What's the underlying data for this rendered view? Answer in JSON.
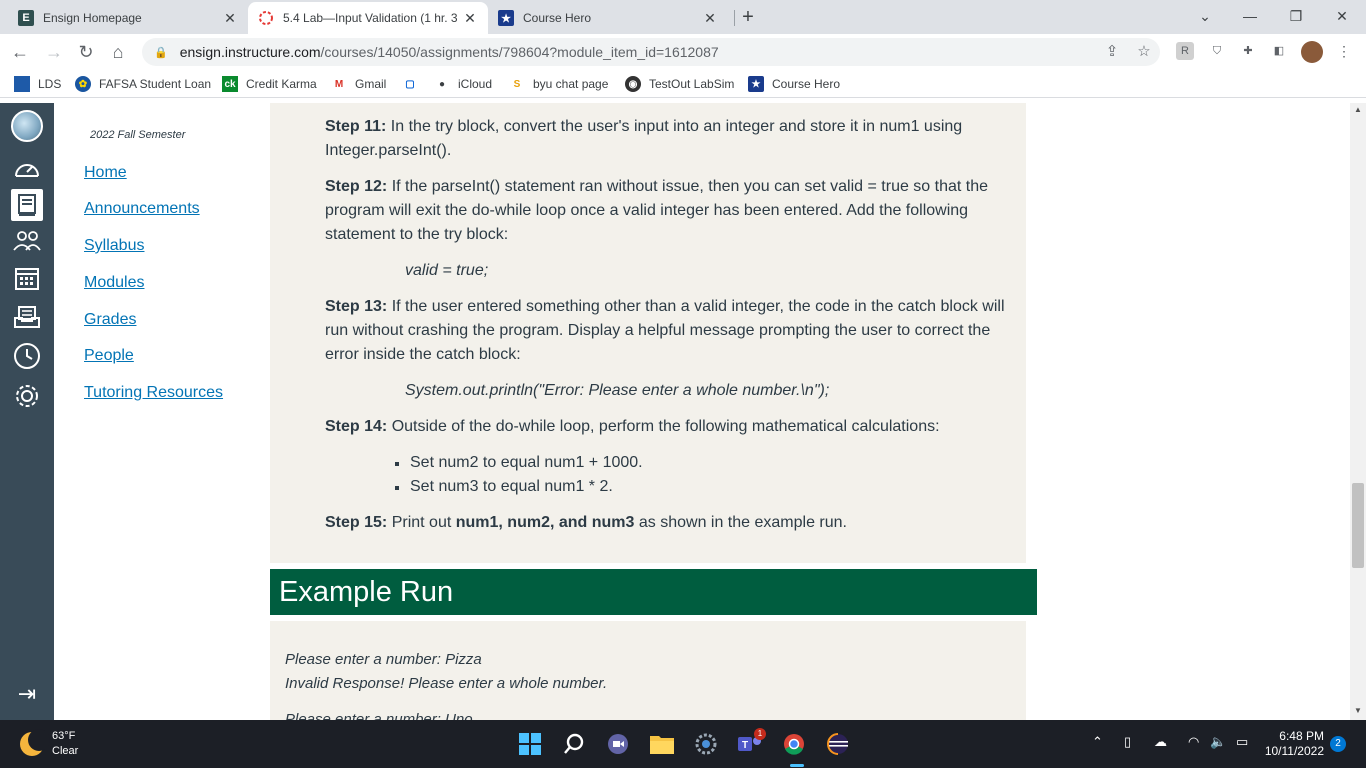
{
  "browser": {
    "tabs": [
      {
        "title": "Ensign Homepage",
        "favicon": "E",
        "active": false
      },
      {
        "title": "5.4 Lab—Input Validation (1 hr. 3",
        "favicon": "",
        "active": true
      },
      {
        "title": "Course Hero",
        "favicon": "★",
        "active": false
      }
    ],
    "url_host": "ensign.instructure.com",
    "url_path": "/courses/14050/assignments/798604?module_item_id=1612087",
    "bookmarks": [
      {
        "label": "LDS"
      },
      {
        "label": "FAFSA Student Loan"
      },
      {
        "label": "Credit Karma",
        "icon": "ck"
      },
      {
        "label": "Gmail",
        "icon": "M"
      },
      {
        "label": "",
        "icon": "▢"
      },
      {
        "label": "iCloud"
      },
      {
        "label": "byu chat page",
        "icon": "S"
      },
      {
        "label": "TestOut LabSim"
      },
      {
        "label": "Course Hero",
        "icon": "★"
      }
    ]
  },
  "coursenav": {
    "semester": "2022 Fall Semester",
    "links": [
      "Home",
      "Announcements",
      "Syllabus",
      "Modules",
      "Grades",
      "People",
      "Tutoring Resources"
    ]
  },
  "content": {
    "step11_label": "Step 11:",
    "step11_text": " In the try block, convert the user's input into an integer and store it in num1 using Integer.parseInt().",
    "step12_label": "Step 12:",
    "step12_text": " If the parseInt() statement ran without issue, then you can set valid = true so that the program will exit the do-while loop once a valid integer has been entered. Add the following statement to the try block:",
    "code1": "valid = true;",
    "step13_label": "Step 13:",
    "step13_text": " If the user entered something other than a valid integer, the code in the catch block will run without crashing the program. Display a helpful message prompting the user to correct the error inside the catch block:",
    "code2": "System.out.println(\"Error: Please enter a whole number.\\n\");",
    "step14_label": "Step 14:",
    "step14_text": " Outside of the do-while loop, perform the following mathematical calculations:",
    "bullets": [
      "Set num2 to equal num1 + 1000.",
      "Set num3 to equal num1 * 2."
    ],
    "step15_label": "Step 15:",
    "step15_pre": " Print out ",
    "step15_bold": "num1, num2, and num3",
    "step15_post": " as shown in the example run.",
    "example_heading": "Example Run",
    "example_lines": [
      "Please enter a number: Pizza",
      "Invalid Response! Please enter a whole number.",
      "Please enter a number: Uno"
    ]
  },
  "taskbar": {
    "temperature": "63°F",
    "condition": "Clear",
    "time": "6:48 PM",
    "date": "10/11/2022",
    "notifications": "2",
    "teams_badge": "1"
  },
  "colors": {
    "canvas_nav": "#394b58",
    "link": "#0374b5",
    "banner": "#005d3f",
    "panel": "#f3f1eb"
  }
}
